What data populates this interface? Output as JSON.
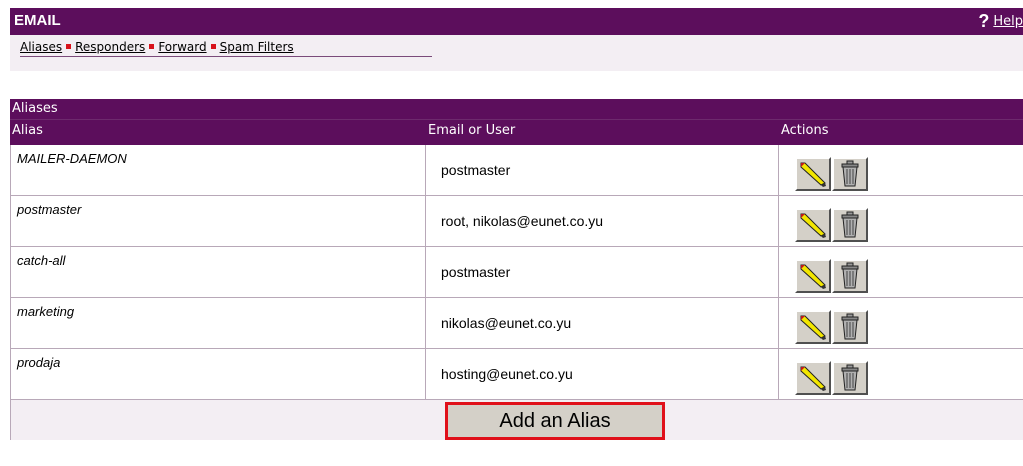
{
  "header": {
    "title": "EMAIL",
    "help_label": "Help"
  },
  "subnav": {
    "items": [
      "Aliases",
      "Responders",
      "Forward",
      "Spam Filters"
    ]
  },
  "panel": {
    "caption": "Aliases",
    "columns": [
      "Alias",
      "Email or User",
      "Actions"
    ],
    "rows": [
      {
        "alias": "MAILER-DAEMON",
        "target": "postmaster"
      },
      {
        "alias": "postmaster",
        "target": "root, nikolas@eunet.co.yu"
      },
      {
        "alias": "catch-all",
        "target": "postmaster"
      },
      {
        "alias": "marketing",
        "target": "nikolas@eunet.co.yu"
      },
      {
        "alias": "prodaja",
        "target": "hosting@eunet.co.yu"
      }
    ],
    "add_button_label": "Add an Alias"
  },
  "colors": {
    "header_bg": "#5c0e5c",
    "subnav_bg": "#f3eef3",
    "separator": "#d8121b",
    "highlight": "#e0101a"
  },
  "icons": {
    "help": "question-mark-icon",
    "edit": "pencil-edit-icon",
    "delete": "trash-can-icon"
  }
}
